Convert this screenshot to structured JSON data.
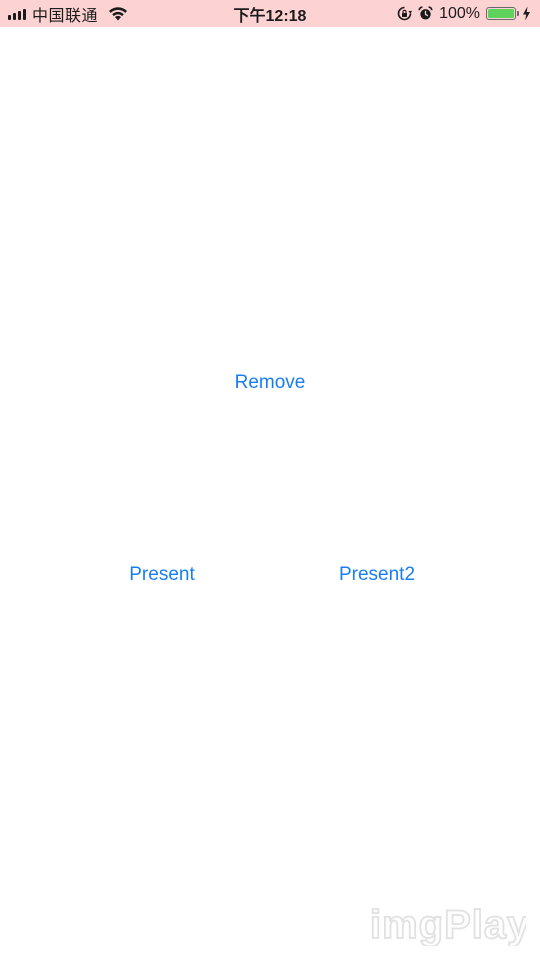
{
  "status_bar": {
    "carrier": "中国联通",
    "time": "下午12:18",
    "battery_percent": "100%",
    "battery_level": 1.0,
    "battery_color": "#5ed35b",
    "background": "#fcd2d2",
    "icons": [
      "signal-bars-icon",
      "wifi-icon",
      "rotation-lock-icon",
      "alarm-icon",
      "battery-icon",
      "charging-bolt-icon"
    ]
  },
  "main": {
    "remove_label": "Remove",
    "present_label": "Present",
    "present2_label": "Present2",
    "accent_color": "#1a7ef2"
  },
  "watermark": {
    "label": "imgPlay"
  }
}
